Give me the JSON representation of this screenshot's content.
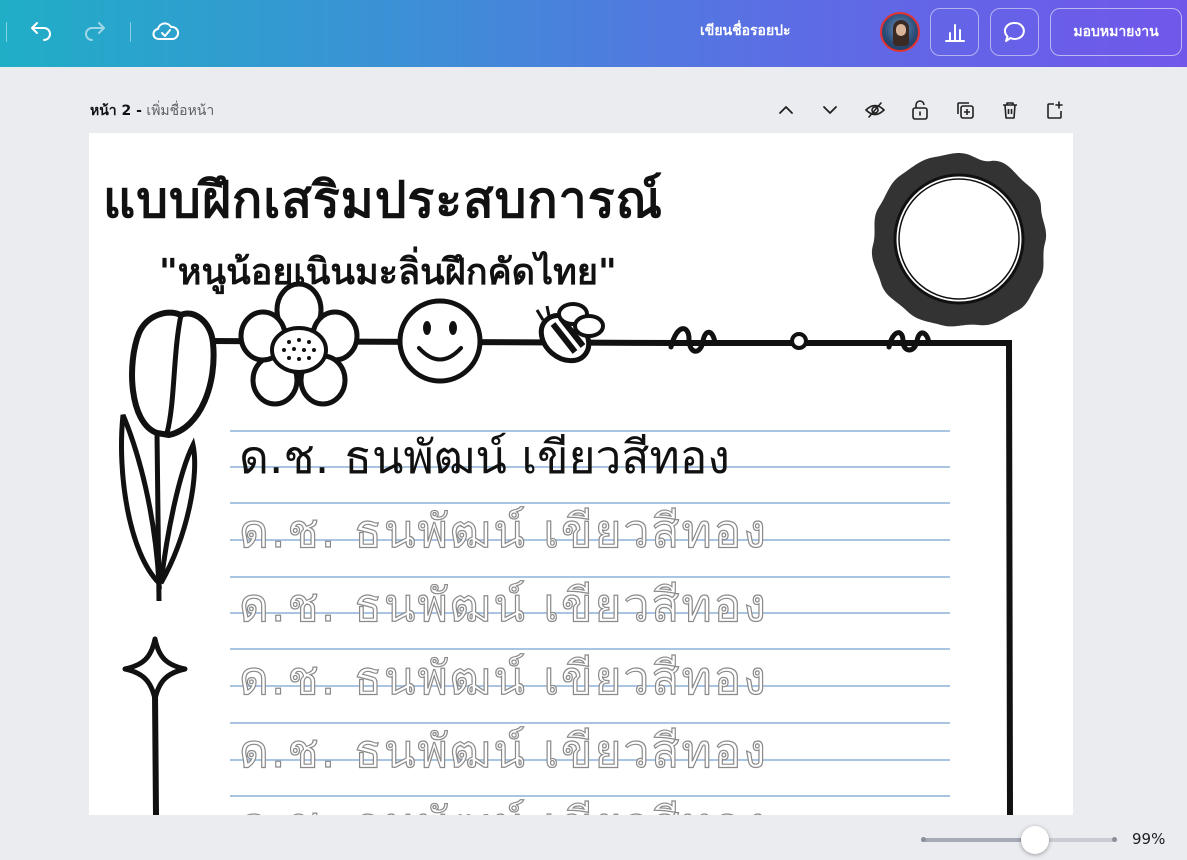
{
  "topbar": {
    "title": "เขียนชื่อรอยปะ",
    "share_label": "มอบหมายงาน",
    "icons": [
      "undo-icon",
      "redo-icon",
      "cloud-saved-icon",
      "avatar",
      "analytics-icon",
      "comment-icon"
    ]
  },
  "page_header": {
    "number": "หน้า 2 -",
    "add_title": "เพิ่มชื่อหน้า",
    "tools": [
      "chevron-up-icon",
      "chevron-down-icon",
      "hide-icon",
      "unlock-icon",
      "duplicate-icon",
      "delete-icon",
      "add-page-icon"
    ]
  },
  "worksheet": {
    "title": "แบบฝึกเสริมประสบการณ์",
    "subtitle": "\"หนูน้อยเนินมะลิ่นฝึกคัดไทย\"",
    "name_solid": "ด.ช. ธนพัฒน์ เขียวสีทอง",
    "name_trace": [
      "ด.ช. ธนพัฒน์ เขียวสีทอง",
      "ด.ช. ธนพัฒน์ เขียวสีทอง",
      "ด.ช. ธนพัฒน์ เขียวสีทอง",
      "ด.ช. ธนพัฒน์ เขียวสีทอง",
      "ด.ช. ธนพัฒน์ เขียวสีทอง"
    ]
  },
  "zoom": {
    "value": "99%",
    "level": 0.58
  },
  "colors": {
    "topbar_start": "#20aec7",
    "topbar_end": "#7057ea",
    "guide_line": "#a9c5e3"
  }
}
